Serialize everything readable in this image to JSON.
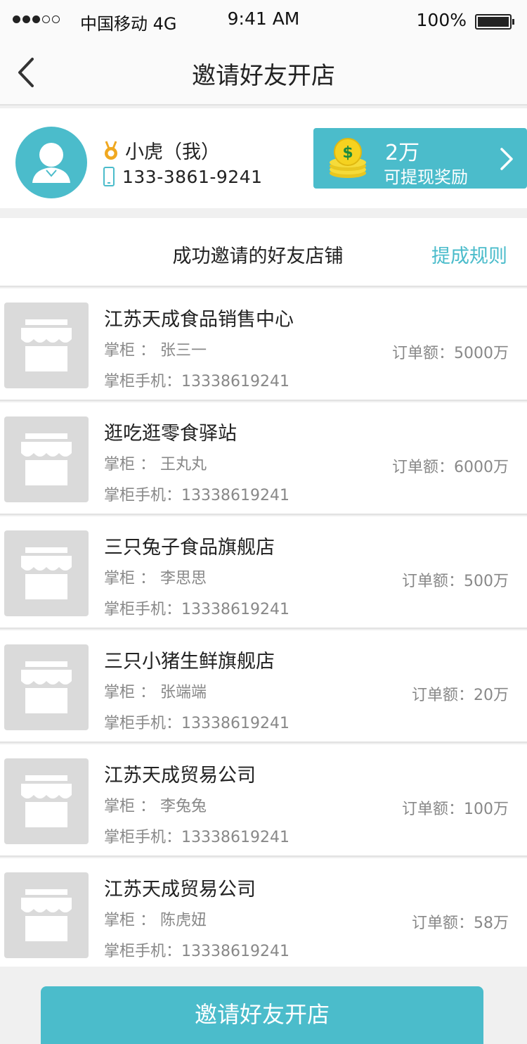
{
  "status_bar": {
    "carrier": "中国移动 4G",
    "time": "9:41 AM",
    "battery": "100%"
  },
  "nav": {
    "title": "邀请好友开店"
  },
  "profile": {
    "name": "小虎（我）",
    "phone": "133-3861-9241"
  },
  "reward": {
    "amount": "2万",
    "label": "可提现奖励"
  },
  "section": {
    "title": "成功邀请的好友店铺",
    "rules_link": "提成规则"
  },
  "shops": [
    {
      "name": "江苏天成食品销售中心",
      "owner": "掌柜 ： 张三一",
      "phone": "掌柜手机：13338619241",
      "amount": "订单额：5000万"
    },
    {
      "name": "逛吃逛零食驿站",
      "owner": "掌柜 ： 王丸丸",
      "phone": "掌柜手机：13338619241",
      "amount": "订单额：6000万"
    },
    {
      "name": "三只兔子食品旗舰店",
      "owner": "掌柜 ： 李思思",
      "phone": "掌柜手机：13338619241",
      "amount": "订单额：500万"
    },
    {
      "name": "三只小猪生鲜旗舰店",
      "owner": "掌柜 ： 张端端",
      "phone": "掌柜手机：13338619241",
      "amount": "订单额：20万"
    },
    {
      "name": "江苏天成贸易公司",
      "owner": "掌柜 ： 李兔兔",
      "phone": "掌柜手机：13338619241",
      "amount": "订单额：100万"
    },
    {
      "name": "江苏天成贸易公司",
      "owner": "掌柜 ： 陈虎妞",
      "phone": "掌柜手机：13338619241",
      "amount": "订单额：58万"
    }
  ],
  "invite_button": "邀请好友开店",
  "colors": {
    "accent": "#4bbccb",
    "badge": "#f0a820"
  },
  "icons": {
    "back": "chevron-left-icon",
    "medal": "medal-icon",
    "phone": "phone-icon",
    "coins": "coin-stack-icon",
    "chevron": "chevron-right-icon",
    "store": "store-icon"
  }
}
